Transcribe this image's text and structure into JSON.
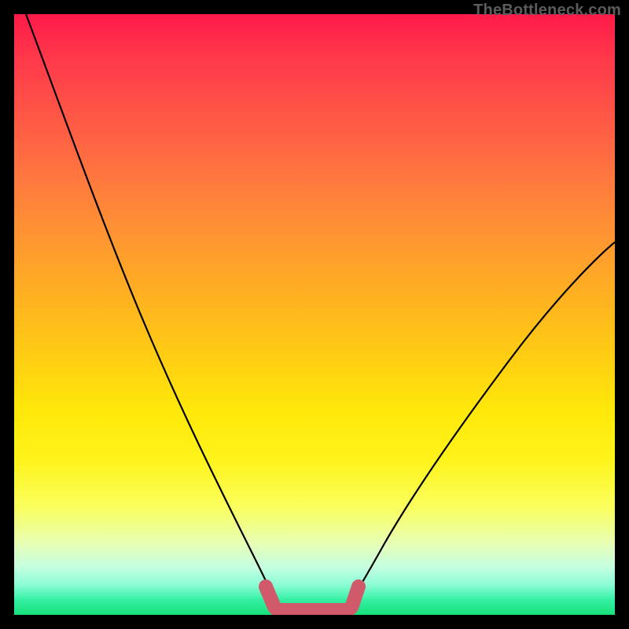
{
  "watermark": "TheBottleneck.com",
  "chart_data": {
    "type": "line",
    "title": "",
    "xlabel": "",
    "ylabel": "",
    "xlim": [
      0,
      100
    ],
    "ylim": [
      0,
      100
    ],
    "grid": false,
    "series": [
      {
        "name": "left-curve",
        "x": [
          2,
          6,
          10,
          14,
          18,
          22,
          26,
          30,
          34,
          37,
          39.5,
          42,
          43
        ],
        "y": [
          100,
          87,
          75,
          63,
          52,
          41,
          31,
          22,
          14,
          8,
          4,
          1.2,
          0.8
        ]
      },
      {
        "name": "right-curve",
        "x": [
          55,
          57,
          60,
          64,
          68,
          72,
          76,
          80,
          84,
          88,
          92,
          96,
          100
        ],
        "y": [
          0.8,
          1.3,
          3.5,
          8,
          13,
          19,
          25,
          31,
          37,
          44,
          50,
          56,
          62
        ]
      },
      {
        "name": "bottom-highlight",
        "x": [
          42,
          43,
          45,
          48,
          51,
          53,
          55,
          56
        ],
        "y": [
          3.5,
          1.2,
          0.6,
          0.6,
          0.6,
          0.6,
          1.2,
          3.5
        ]
      }
    ],
    "colors": {
      "curve": "#000000",
      "highlight": "#d15a6a",
      "gradient_top": "#ff1a4a",
      "gradient_bottom": "#17e07a"
    }
  }
}
